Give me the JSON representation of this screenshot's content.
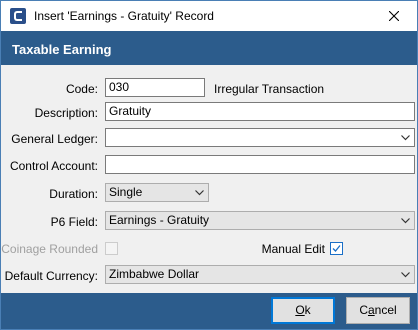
{
  "window": {
    "title": "Insert 'Earnings - Gratuity' Record",
    "close_symbol": "✕"
  },
  "header": {
    "title": "Taxable Earning"
  },
  "form": {
    "code": {
      "label": "Code:",
      "value": "030",
      "note": "Irregular Transaction"
    },
    "description": {
      "label": "Description:",
      "value": "Gratuity"
    },
    "general_ledger": {
      "label": "General Ledger:",
      "value": ""
    },
    "control_account": {
      "label": "Control Account:",
      "value": ""
    },
    "duration": {
      "label": "Duration:",
      "value": "Single"
    },
    "p6_field": {
      "label": "P6 Field:",
      "value": "Earnings - Gratuity"
    },
    "coinage_rounded": {
      "label": "Coinage Rounded",
      "checked": false,
      "enabled": false
    },
    "manual_edit": {
      "label": "Manual Edit",
      "checked": true
    },
    "default_currency": {
      "label": "Default Currency:",
      "value": "Zimbabwe Dollar"
    }
  },
  "buttons": {
    "ok": {
      "first": "O",
      "rest": "k"
    },
    "cancel": {
      "pre": "C",
      "under": "a",
      "rest": "ncel"
    }
  },
  "colors": {
    "accent": "#2c5c8c",
    "focus": "#0078d7"
  }
}
